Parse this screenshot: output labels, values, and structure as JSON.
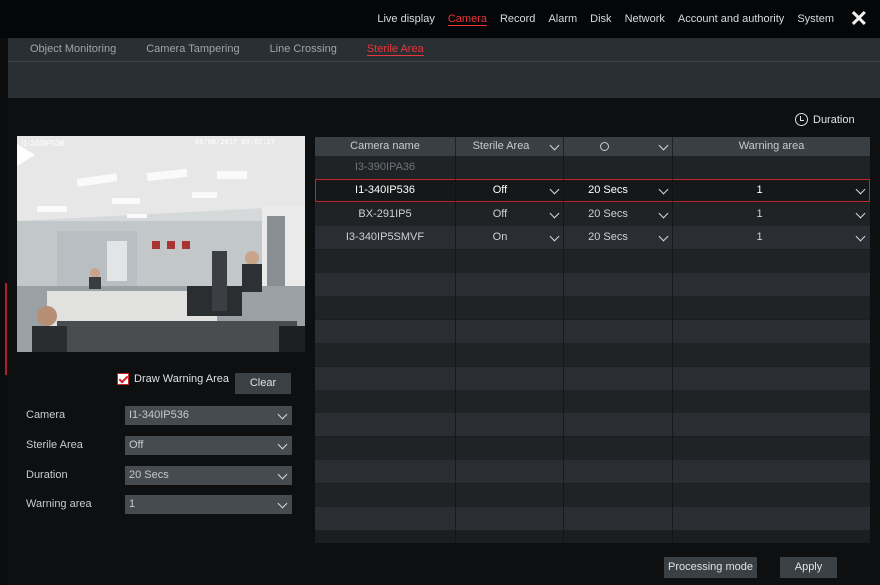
{
  "nav": {
    "items": [
      "Live display",
      "Camera",
      "Record",
      "Alarm",
      "Disk",
      "Network",
      "Account and authority",
      "System"
    ],
    "active": "Camera",
    "close_icon": "close-icon"
  },
  "subtabs": {
    "items": [
      "Object Monitoring",
      "Camera Tampering",
      "Line Crossing",
      "Sterile Area"
    ],
    "active": "Sterile Area"
  },
  "duration_link": {
    "label": "Duration",
    "icon": "clock-icon"
  },
  "preview": {
    "camera_name": "I1-340IP536",
    "timestamp": "08/08/2017 09:02:27",
    "play_icon": "play-icon"
  },
  "draw_warning_area": {
    "label": "Draw Warning Area",
    "checked": true
  },
  "clear_button": "Clear",
  "form": {
    "camera": {
      "label": "Camera",
      "value": "I1-340IP536"
    },
    "sterile_area": {
      "label": "Sterile Area",
      "value": "Off"
    },
    "duration": {
      "label": "Duration",
      "value": "20 Secs"
    },
    "warning_area": {
      "label": "Warning area",
      "value": "1"
    }
  },
  "table": {
    "headers": {
      "camera_name": "Camera name",
      "sterile_area": "Sterile Area",
      "duration_icon": "clock-icon",
      "warning_area": "Warning area"
    },
    "rows": [
      {
        "camera": "I3-390IPA36",
        "sterile": "",
        "duration": "",
        "warning": "",
        "dim": true
      },
      {
        "camera": "I1-340IP536",
        "sterile": "Off",
        "duration": "20 Secs",
        "warning": "1",
        "selected": true
      },
      {
        "camera": "BX-291IP5",
        "sterile": "Off",
        "duration": "20 Secs",
        "warning": "1"
      },
      {
        "camera": "I3-340IP5SMVF",
        "sterile": "On",
        "duration": "20 Secs",
        "warning": "1"
      }
    ],
    "empty_rows": 12
  },
  "buttons": {
    "processing_mode": "Processing mode",
    "apply": "Apply"
  },
  "colors": {
    "accent": "#e8363b",
    "background": "#0b0c0e",
    "panel": "#2a2f33",
    "header_row": "#3a3f44"
  }
}
